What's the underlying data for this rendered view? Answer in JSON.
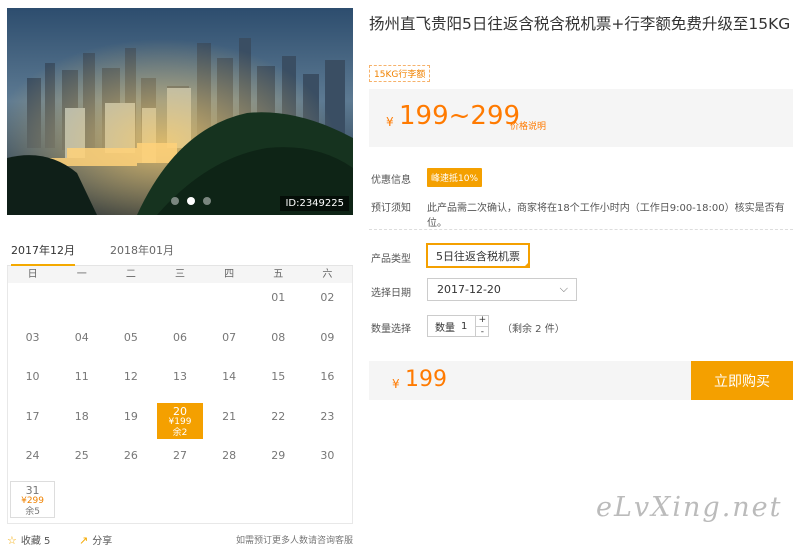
{
  "product": {
    "title": "扬州直飞贵阳5日往返含税含税机票+行李额免费升级至15KG",
    "tag": "15KG行李额",
    "image_id": "ID:2349225"
  },
  "price": {
    "currency": "¥",
    "range": "199~299",
    "explain_link": "价格说明"
  },
  "info": {
    "promo_label": "优惠信息",
    "promo_badge": "峰速抵10%",
    "notice_label": "预订须知",
    "notice_text": "此产品需二次确认，商家将在18个工作小时内（工作日9:00-18:00）核实是否有位。"
  },
  "options": {
    "type_label": "产品类型",
    "type_value": "5日往返含税机票",
    "date_label": "选择日期",
    "date_value": "2017-12-20",
    "qty_label": "数量选择",
    "qty_field_label": "数量",
    "qty_value": "1",
    "plus": "+",
    "minus": "-",
    "stock": "（剩余 2 件）"
  },
  "buy": {
    "currency": "¥",
    "total": "199",
    "button": "立即购买"
  },
  "calendar": {
    "tabs": [
      "2017年12月",
      "2018年01月"
    ],
    "weekdays": [
      "日",
      "一",
      "二",
      "三",
      "四",
      "五",
      "六"
    ],
    "weeks": [
      [
        "",
        "",
        "",
        "",
        "",
        "01",
        "02"
      ],
      [
        "03",
        "04",
        "05",
        "06",
        "07",
        "08",
        "09"
      ],
      [
        "10",
        "11",
        "12",
        "13",
        "14",
        "15",
        "16"
      ],
      [
        "17",
        "18",
        "19",
        "20",
        "21",
        "22",
        "23"
      ],
      [
        "24",
        "25",
        "26",
        "27",
        "28",
        "29",
        "30"
      ],
      [
        "31",
        "",
        "",
        "",
        "",
        "",
        ""
      ]
    ],
    "selected_price": "¥199",
    "selected_left": "余2",
    "last_price": "¥299",
    "last_left": "余5"
  },
  "bottom": {
    "favorite": "收藏 5",
    "share": "分享",
    "more": "如需预订更多人数请咨询客服"
  },
  "watermark": "eLvXing.net",
  "colors": {
    "accent": "#f4a000",
    "price": "#ff7a00"
  }
}
